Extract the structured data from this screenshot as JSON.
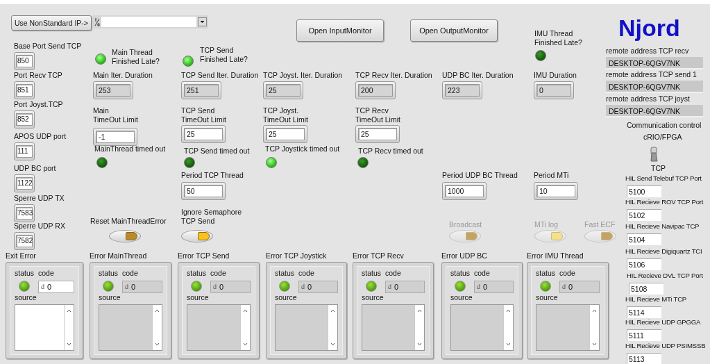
{
  "ip_button": "Use NonStandard IP->",
  "monitor_buttons": [
    "Open InputMonitor",
    "Open OutputMonitor"
  ],
  "logo": "Njord",
  "ports": [
    {
      "label": "Base Port Send TCP",
      "value": "850"
    },
    {
      "label": "Port Recv TCP",
      "value": "851"
    },
    {
      "label": "Port Joyst.TCP",
      "value": "852"
    },
    {
      "label": "APOS UDP port",
      "value": "111"
    },
    {
      "label": "UDP BC port",
      "value": "1122"
    },
    {
      "label": "Sperre UDP TX",
      "value": "7583"
    },
    {
      "label": "Sperre UDP RX",
      "value": "7582"
    }
  ],
  "leds": [
    {
      "label": "Main Thread\nFinished Late?",
      "on": true
    },
    {
      "label": "TCP Send\nFinished Late?",
      "on": true
    },
    {
      "label": "IMU Thread\nFinished Late?",
      "on": false
    },
    {
      "label": "MainThread timed out",
      "on": false
    },
    {
      "label": "TCP Send timed out",
      "on": false
    },
    {
      "label": "TCP Joystick timed out",
      "on": true
    },
    {
      "label": "TCP Recv timed out",
      "on": false
    }
  ],
  "durations": [
    {
      "label": "Main Iter. Duration",
      "value": "253"
    },
    {
      "label": "TCP Send Iter. Duration",
      "value": "251"
    },
    {
      "label": "TCP Joyst. Iter. Duration",
      "value": "25"
    },
    {
      "label": "TCP Recv Iter. Duration",
      "value": "200"
    },
    {
      "label": "UDP BC Iter. Duration",
      "value": "223"
    },
    {
      "label": "IMU Duration",
      "value": "0"
    }
  ],
  "settings": [
    {
      "label": "Main\nTimeOut Limit",
      "value": "-1"
    },
    {
      "label": "TCP Send\nTimeOut Limit",
      "value": "25"
    },
    {
      "label": "TCP Joyst.\nTimeOut Limit",
      "value": "25"
    },
    {
      "label": "TCP Recv\nTimeOut Limit",
      "value": "25"
    },
    {
      "label": "Period TCP Thread",
      "value": "50"
    },
    {
      "label": "Period UDP BC Thread",
      "value": "1000"
    },
    {
      "label": "Period MTi",
      "value": "10"
    }
  ],
  "toggles": [
    {
      "label": "Reset MainThreadError",
      "on": false,
      "disabled": false
    },
    {
      "label": "Ignore Semaphore\nTCP Send",
      "on": true,
      "disabled": false
    },
    {
      "label": "Broadcast",
      "on": false,
      "disabled": true
    },
    {
      "label": "MTi log",
      "on": true,
      "disabled": true
    },
    {
      "label": "Fast ECF",
      "on": false,
      "disabled": true
    }
  ],
  "remote_addresses": [
    {
      "label": "remote address TCP recv",
      "value": "DESKTOP-6QGV7NK"
    },
    {
      "label": "remote address TCP send 1",
      "value": "DESKTOP-6QGV7NK"
    },
    {
      "label": "remote address TCP joyst",
      "value": "DESKTOP-6QGV7NK"
    }
  ],
  "communication_control": {
    "label": "Communication control",
    "top_label": "cRIO/FPGA",
    "bottom_label": "TCP",
    "on": false
  },
  "hil_ports": [
    {
      "label": "HIL Send Telebuf TCP Port",
      "value": "5100"
    },
    {
      "label": "HIL Recieve ROV TCP Port",
      "value": "5102"
    },
    {
      "label": "HIL Recieve Navipac TCP",
      "value": "5104"
    },
    {
      "label": "HIL Recieve Digiquartz TCI",
      "value": "5106"
    },
    {
      "label": "HIL Recieve DVL TCP Port",
      "value": "5108"
    },
    {
      "label": "HIL Recieve MTi TCP",
      "value": "5114"
    },
    {
      "label": "HIL Recieve UDP GPGGA",
      "value": "5111"
    },
    {
      "label": "HIL Recieve UDP PSIMSSB",
      "value": "5113"
    }
  ],
  "error_clusters": [
    {
      "title": "Exit Error",
      "kind": "control",
      "status_label": "status",
      "code_label": "code",
      "source_label": "source",
      "status": false,
      "radix": "d",
      "code": "0"
    },
    {
      "title": "Error MainThread",
      "kind": "indicator",
      "status_label": "status",
      "code_label": "code",
      "source_label": "source",
      "status": false,
      "radix": "d",
      "code": "0"
    },
    {
      "title": "Error TCP Send",
      "kind": "indicator",
      "status_label": "status",
      "code_label": "code",
      "source_label": "source",
      "status": false,
      "radix": "d",
      "code": "0"
    },
    {
      "title": "Error TCP Joystick",
      "kind": "indicator",
      "status_label": "status",
      "code_label": "code",
      "source_label": "source",
      "status": false,
      "radix": "d",
      "code": "0"
    },
    {
      "title": "Error TCP Recv",
      "kind": "indicator",
      "status_label": "status",
      "code_label": "code",
      "source_label": "source",
      "status": false,
      "radix": "d",
      "code": "0"
    },
    {
      "title": "Error UDP BC",
      "kind": "indicator",
      "status_label": "status",
      "code_label": "code",
      "source_label": "source",
      "status": false,
      "radix": "d",
      "code": "0"
    },
    {
      "title": "Error IMU Thread",
      "kind": "indicator",
      "status_label": "status",
      "code_label": "code",
      "source_label": "source",
      "status": false,
      "radix": "d",
      "code": "0"
    }
  ]
}
